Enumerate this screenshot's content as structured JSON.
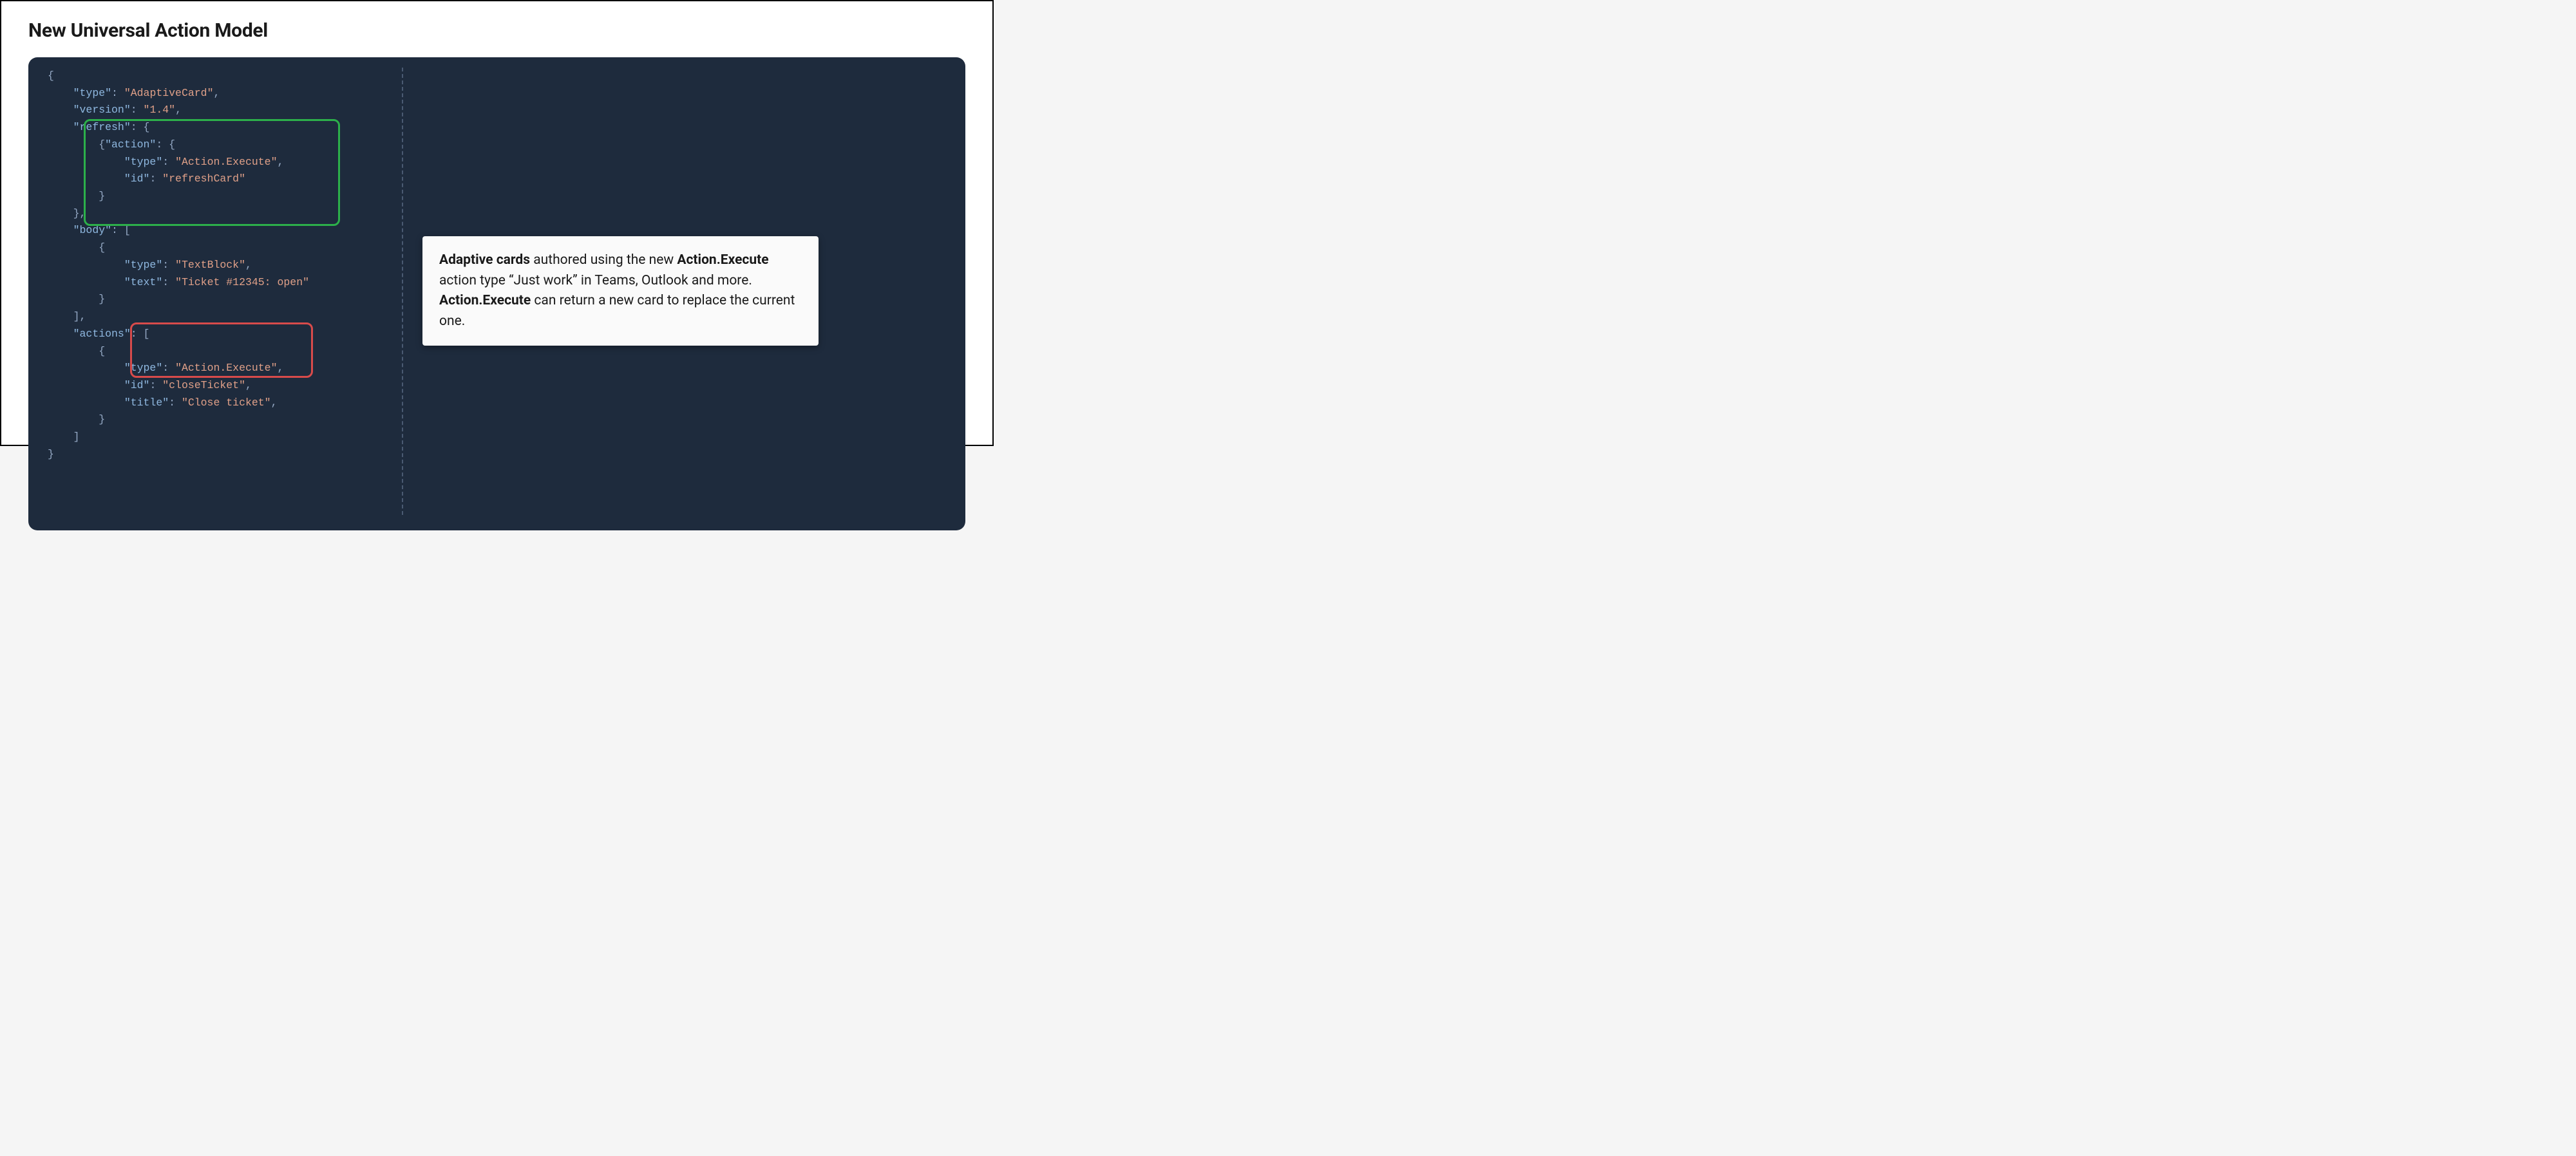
{
  "title": "New Universal Action Model",
  "code": {
    "l1a": "\"type\"",
    "l1b": "\"AdaptiveCard\"",
    "l2a": "\"version\"",
    "l2b": "\"1.4\"",
    "l3a": "\"refresh\"",
    "l4a": "\"action\"",
    "l5a": "\"type\"",
    "l5b": "\"Action.Execute\"",
    "l6a": "\"id\"",
    "l6b": "\"refreshCard\"",
    "l9a": "\"body\"",
    "l11a": "\"type\"",
    "l11b": "\"TextBlock\"",
    "l12a": "\"text\"",
    "l12b": "\"Ticket #12345: open\"",
    "l15a": "\"actions\"",
    "l17a": "\"type\"",
    "l17b": "\"Action.Execute\"",
    "l18a": "\"id\"",
    "l18b": "\"closeTicket\"",
    "l19a": "\"title\"",
    "l19b": "\"Close ticket\""
  },
  "desc": {
    "b1": "Adaptive cards",
    "t1": " authored using the new ",
    "b2": "Action.Execute",
    "t2": " action type “Just work” in Teams, Outlook and more. ",
    "b3": "Action.Execute",
    "t3": " can return a new card to replace the current one."
  }
}
